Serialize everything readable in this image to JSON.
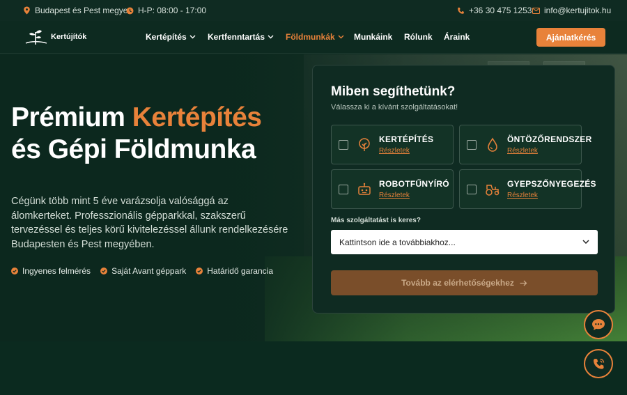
{
  "topbar": {
    "location": "Budapest és Pest megye",
    "hours": "H-P: 08:00 - 17:00",
    "phone": "+36 30 475 1253",
    "email": "info@kertujitok.hu"
  },
  "nav": {
    "logo": "Kertújítók",
    "items": [
      {
        "label": "Kertépítés",
        "dropdown": true
      },
      {
        "label": "Kertfenntartás",
        "dropdown": true
      },
      {
        "label": "Földmunkák",
        "dropdown": true,
        "active": true
      },
      {
        "label": "Munkáink"
      },
      {
        "label": "Rólunk"
      },
      {
        "label": "Áraink"
      }
    ],
    "cta": "Ajánlatkérés"
  },
  "hero": {
    "title_part1": "Prémium ",
    "title_accent": "Kertépítés",
    "title_part2": "és Gépi Földmunka",
    "lead": "Cégünk több mint 5 éve varázsolja valósággá az álomkerteket. Professzionális gépparkkal, szakszerű tervezéssel és teljes körű kivitelezéssel állunk rendelkezésére Budapesten és Pest megyében.",
    "features": [
      "Ingyenes felmérés",
      "Saját Avant géppark",
      "Határidő garancia"
    ]
  },
  "panel": {
    "title": "Miben segíthetünk?",
    "subtitle": "Válassza ki a kívánt szolgáltatásokat!",
    "services": [
      {
        "label": "KERTÉPÍTÉS",
        "link": "Részletek",
        "icon": "tree-icon"
      },
      {
        "label": "ÖNTÖZŐRENDSZER",
        "link": "Részletek",
        "icon": "water-drop-icon"
      },
      {
        "label": "ROBOTFŰNYÍRÓ",
        "link": "Részletek",
        "icon": "robot-icon"
      },
      {
        "label": "GYEPSZŐNYEGEZÉS",
        "link": "Részletek",
        "icon": "tractor-icon"
      }
    ],
    "more_label": "Más szolgáltatást is keres?",
    "select_value": "Kattintson ide a továbbiakhoz...",
    "button": "Tovább az elérhetőségekhez"
  },
  "colors": {
    "accent": "#e8823a",
    "background": "#0d2a20"
  }
}
